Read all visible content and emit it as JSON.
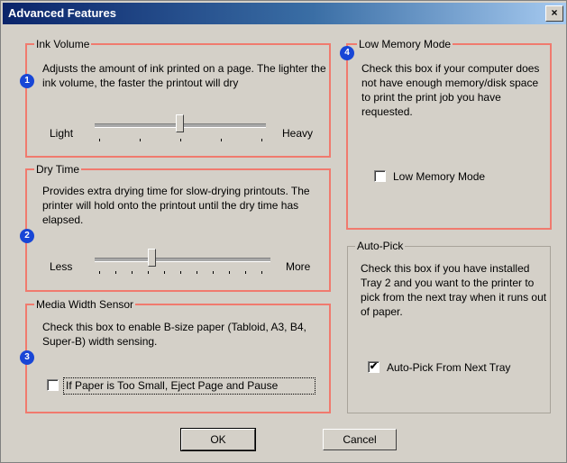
{
  "window": {
    "title": "Advanced Features",
    "close_label": "×"
  },
  "ink_volume": {
    "title": "Ink Volume",
    "badge": "1",
    "description": "Adjusts the amount of ink printed on a page. The lighter the ink volume, the faster the printout will dry",
    "min_label": "Light",
    "max_label": "Heavy",
    "position": 3,
    "ticks": 5
  },
  "dry_time": {
    "title": "Dry Time",
    "badge": "2",
    "description": "Provides extra drying time for slow-drying printouts. The printer will hold onto the printout until the dry time has elapsed.",
    "min_label": "Less",
    "max_label": "More",
    "position": 3,
    "ticks": 11
  },
  "media_width": {
    "title": "Media Width Sensor",
    "badge": "3",
    "description": "Check this box to enable B-size paper (Tabloid, A3, B4, Super-B) width sensing.",
    "checkbox_label": "If Paper is Too Small, Eject Page and Pause",
    "checked": false
  },
  "low_memory": {
    "title": "Low Memory Mode",
    "badge": "4",
    "description": "Check this box if your computer does not have enough memory/disk space to print the print job you have requested.",
    "checkbox_label": "Low Memory Mode",
    "checked": false
  },
  "auto_pick": {
    "title": "Auto-Pick",
    "description": "Check this box if you have installed Tray 2 and you want to the printer to pick from the next tray when it runs out of paper.",
    "checkbox_label": "Auto-Pick From Next Tray",
    "checked": true,
    "check_mark": "✔"
  },
  "buttons": {
    "ok": "OK",
    "cancel": "Cancel"
  }
}
